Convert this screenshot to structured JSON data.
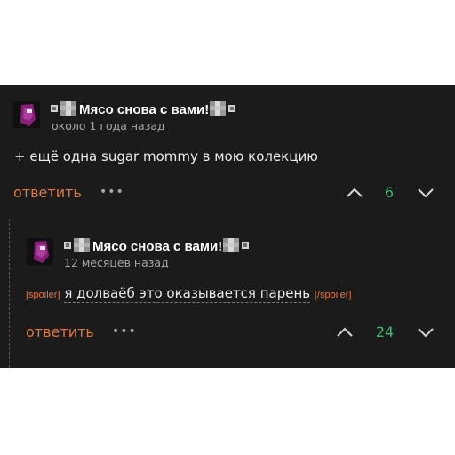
{
  "comments": [
    {
      "username": "Мясо снова с вами!",
      "time": "около 1 года назад",
      "text": "+ ещё одна sugar mommy в мою колекцию",
      "reply_label": "ответить",
      "more_label": "•••",
      "score": "6"
    },
    {
      "username": "Мясо снова с вами!",
      "time": "12 месяцев назад",
      "spoiler_open": "[spoiler]",
      "text": "я долваёб это оказывается парень",
      "spoiler_close": "[/spoiler]",
      "reply_label": "ответить",
      "more_label": "•••",
      "score": "24"
    }
  ],
  "colors": {
    "background": "#1b1b1b",
    "accent": "#e0783f",
    "score": "#3fb976",
    "text": "#ececec",
    "muted": "#a6a6a6"
  },
  "icons": [
    "avatar",
    "checker-decoration",
    "more-dots-icon",
    "upvote-chevron-icon",
    "downvote-chevron-icon"
  ]
}
